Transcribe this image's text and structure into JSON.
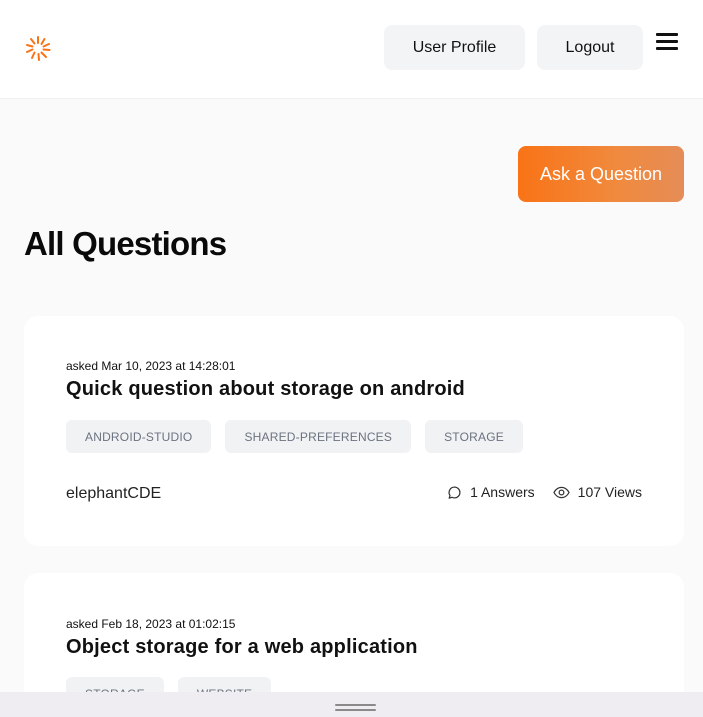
{
  "header": {
    "user_profile_label": "User Profile",
    "logout_label": "Logout"
  },
  "brand": {
    "accent_color": "#f97316"
  },
  "main": {
    "ask_button_label": "Ask a Question",
    "title": "All Questions"
  },
  "questions": [
    {
      "asked": "asked Mar 10, 2023 at 14:28:01",
      "title": "Quick question about storage on android",
      "tags": [
        "ANDROID-STUDIO",
        "SHARED-PREFERENCES",
        "STORAGE"
      ],
      "author": "elephantCDE",
      "answers": "1 Answers",
      "views": "107 Views"
    },
    {
      "asked": "asked Feb 18, 2023 at 01:02:15",
      "title": "Object storage for a web application",
      "tags": [
        "STORAGE",
        "WEBSITE"
      ]
    }
  ]
}
